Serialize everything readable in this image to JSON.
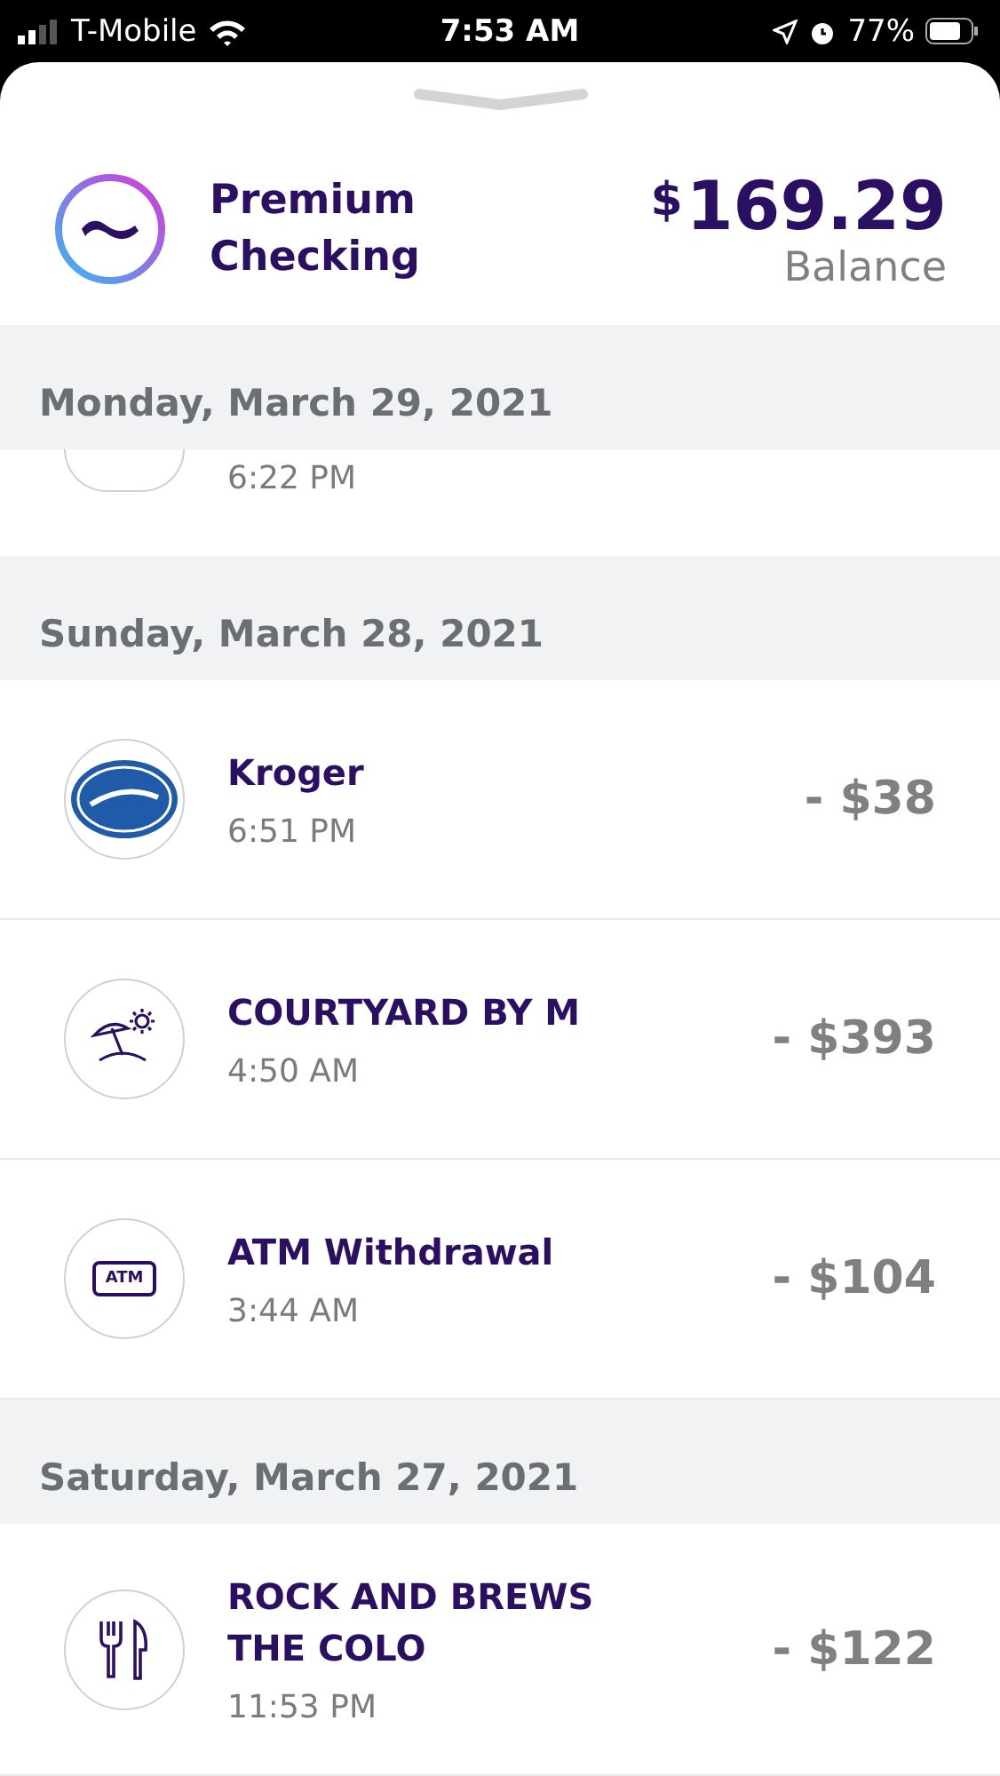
{
  "status_bar": {
    "carrier": "T-Mobile",
    "time": "7:53 AM",
    "battery": "77%"
  },
  "account": {
    "name": "Premium\nChecking",
    "currency": "$",
    "balance": "169.29",
    "balance_label": "Balance"
  },
  "sections": [
    {
      "date": "Monday, March 29, 2021",
      "transactions": [
        {
          "kind": "cut",
          "time": "6:22 PM"
        }
      ]
    },
    {
      "date": "Sunday, March 28, 2021",
      "transactions": [
        {
          "kind": "store",
          "name": "Kroger",
          "time": "6:51 PM",
          "amount": "- $38"
        },
        {
          "kind": "hotel",
          "name": "COURTYARD BY M",
          "time": "4:50 AM",
          "amount": "- $393"
        },
        {
          "kind": "atm",
          "icon_label": "ATM",
          "name": "ATM Withdrawal",
          "time": "3:44 AM",
          "amount": "- $104"
        }
      ]
    },
    {
      "date": "Saturday, March 27, 2021",
      "transactions": [
        {
          "kind": "food",
          "name": "ROCK AND BREWS\nTHE COLO",
          "time": "11:53 PM",
          "amount": "- $122"
        }
      ]
    }
  ]
}
